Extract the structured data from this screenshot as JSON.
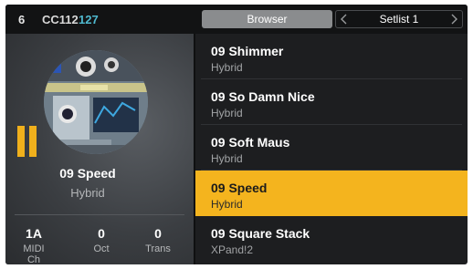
{
  "topbar": {
    "channel": "6",
    "cc_label": "CC112",
    "cc_value": "127",
    "browser_label": "Browser",
    "setlist_label": "Setlist 1"
  },
  "current_preset": {
    "name": "09 Speed",
    "type": "Hybrid",
    "state": "paused"
  },
  "params": [
    {
      "value": "1A",
      "label": "MIDI Ch"
    },
    {
      "value": "0",
      "label": "Oct"
    },
    {
      "value": "0",
      "label": "Trans"
    }
  ],
  "presets": [
    {
      "name": "09 Shimmer",
      "type": "Hybrid"
    },
    {
      "name": "09 So Damn Nice",
      "type": "Hybrid"
    },
    {
      "name": "09 Soft Maus",
      "type": "Hybrid"
    },
    {
      "name": "09 Speed",
      "type": "Hybrid",
      "selected": true
    },
    {
      "name": "09 Square Stack",
      "type": "XPand!2"
    }
  ],
  "colors": {
    "accent": "#f4b41e",
    "cc_value": "#4fb9cf",
    "background": "#1d1e20"
  },
  "icons": [
    "pause-icon",
    "chevron-left-icon",
    "chevron-right-icon",
    "instrument-thumbnail"
  ]
}
